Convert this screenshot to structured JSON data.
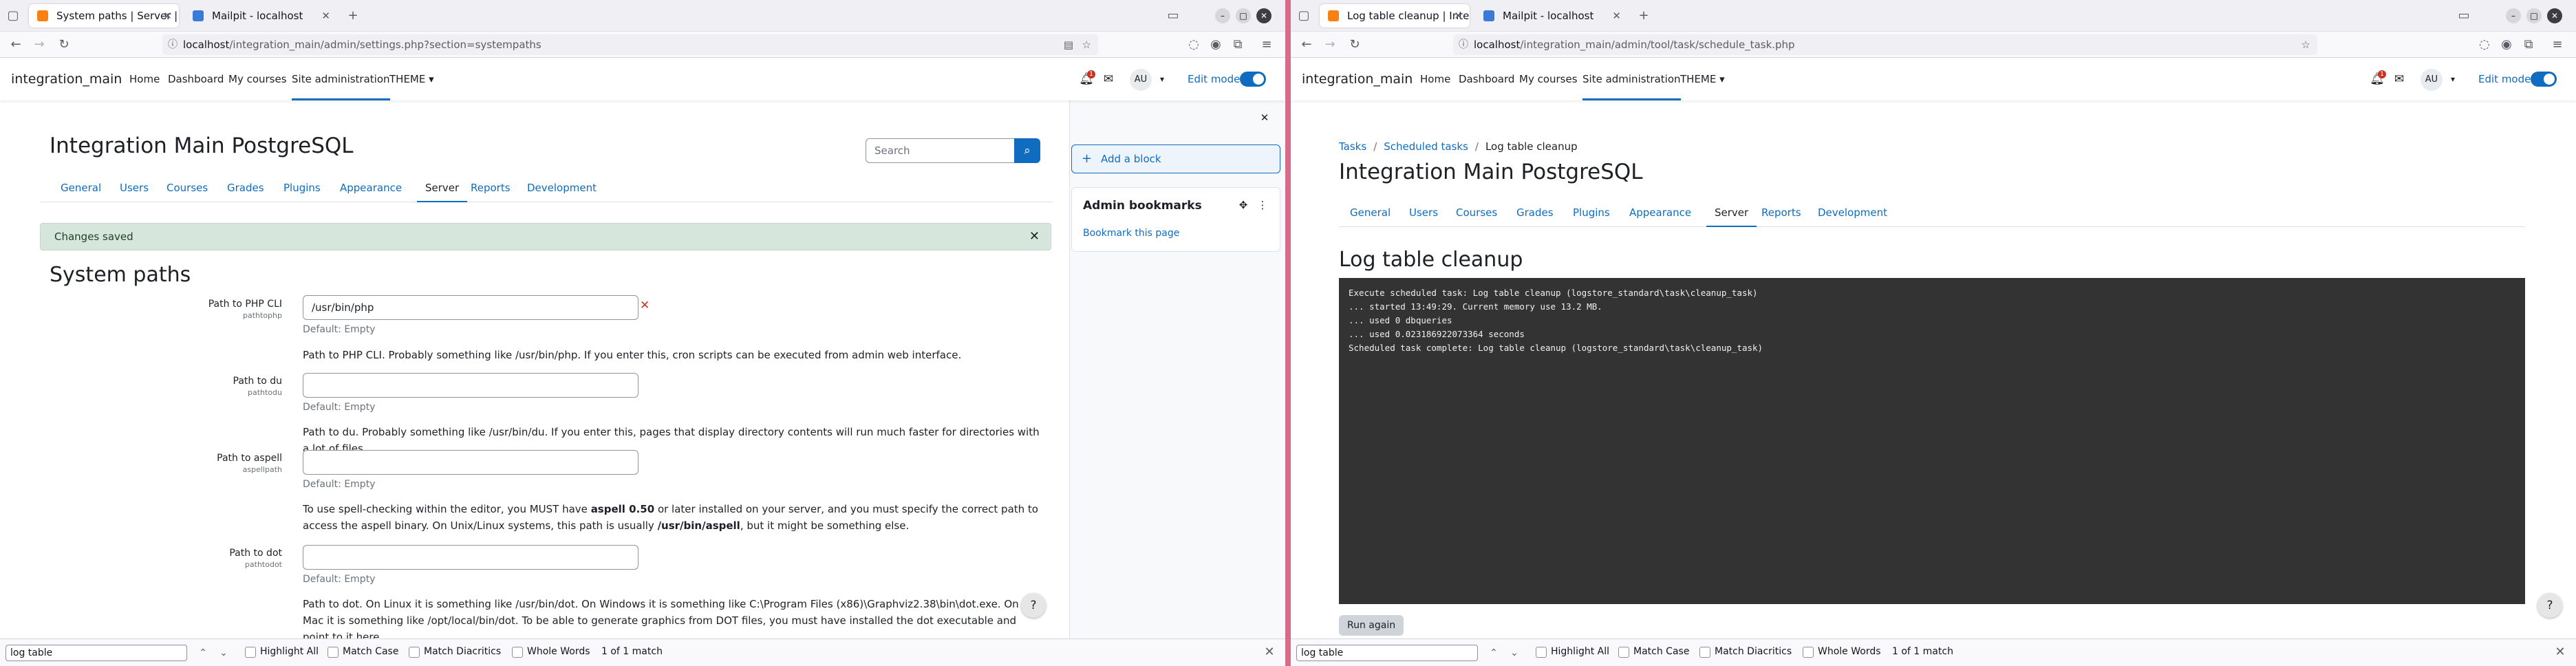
{
  "left": {
    "tabs": [
      {
        "title": "System paths | Server | A"
      },
      {
        "title": "Mailpit - localhost"
      }
    ],
    "url": {
      "host": "localhost",
      "path": "/integration_main/admin/settings.php?section=systempaths"
    },
    "site_name": "integration_main",
    "primary_nav": [
      "Home",
      "Dashboard",
      "My courses",
      "Site administration",
      "THEME"
    ],
    "user_initials": "AU",
    "edit_mode_label": "Edit mode",
    "notif_count": "1",
    "page_heading": "Integration Main PostgreSQL",
    "search_placeholder": "Search",
    "secondary_nav": [
      "General",
      "Users",
      "Courses",
      "Grades",
      "Plugins",
      "Appearance",
      "Server",
      "Reports",
      "Development"
    ],
    "alert": "Changes saved",
    "section_title": "System paths",
    "settings": [
      {
        "label": "Path to PHP CLI",
        "name": "pathtophp",
        "value": "/usr/bin/php",
        "default": "Default: Empty",
        "desc": "Path to PHP CLI. Probably something like /usr/bin/php. If you enter this, cron scripts can be executed from admin web interface."
      },
      {
        "label": "Path to du",
        "name": "pathtodu",
        "value": "",
        "default": "Default: Empty",
        "desc": "Path to du. Probably something like /usr/bin/du. If you enter this, pages that display directory contents will run much faster for directories with a lot of files."
      },
      {
        "label": "Path to aspell",
        "name": "aspellpath",
        "value": "",
        "default": "Default: Empty",
        "desc_a": "To use spell-checking within the editor, you MUST have ",
        "desc_b": "aspell 0.50",
        "desc_c": " or later installed on your server, and you must specify the correct path to access the aspell binary. On Unix/Linux systems, this path is usually ",
        "desc_d": "/usr/bin/aspell",
        "desc_e": ", but it might be something else."
      },
      {
        "label": "Path to dot",
        "name": "pathtodot",
        "value": "",
        "default": "Default: Empty",
        "desc": "Path to dot. On Linux it is something like /usr/bin/dot. On Windows it is something like C:\\Program Files (x86)\\Graphviz2.38\\bin\\dot.exe. On Mac it is something like /opt/local/bin/dot. To be able to generate graphics from DOT files, you must have installed the dot executable and point to it here."
      }
    ],
    "drawer": {
      "add_block": "Add a block",
      "block_title": "Admin bookmarks",
      "bookmark_link": "Bookmark this page"
    },
    "find": {
      "query": "log table",
      "options": [
        "Highlight All",
        "Match Case",
        "Match Diacritics",
        "Whole Words"
      ],
      "count": "1 of 1 match"
    }
  },
  "right": {
    "tabs": [
      {
        "title": "Log table cleanup | Integ"
      },
      {
        "title": "Mailpit - localhost"
      }
    ],
    "url": {
      "host": "localhost",
      "path": "/integration_main/admin/tool/task/schedule_task.php"
    },
    "site_name": "integration_main",
    "primary_nav": [
      "Home",
      "Dashboard",
      "My courses",
      "Site administration",
      "THEME"
    ],
    "user_initials": "AU",
    "edit_mode_label": "Edit mode",
    "notif_count": "1",
    "breadcrumb": [
      "Tasks",
      "Scheduled tasks",
      "Log table cleanup"
    ],
    "page_heading": "Integration Main PostgreSQL",
    "secondary_nav": [
      "General",
      "Users",
      "Courses",
      "Grades",
      "Plugins",
      "Appearance",
      "Server",
      "Reports",
      "Development"
    ],
    "section_title": "Log table cleanup",
    "console_lines": [
      "Execute scheduled task: Log table cleanup (logstore_standard\\task\\cleanup_task)",
      "... started 13:49:29. Current memory use 13.2 MB.",
      "... used 0 dbqueries",
      "... used 0.023186922073364 seconds",
      "Scheduled task complete: Log table cleanup (logstore_standard\\task\\cleanup_task)"
    ],
    "run_again": "Run again",
    "find": {
      "query": "log table",
      "options": [
        "Highlight All",
        "Match Case",
        "Match Diacritics",
        "Whole Words"
      ],
      "count": "1 of 1 match"
    }
  }
}
